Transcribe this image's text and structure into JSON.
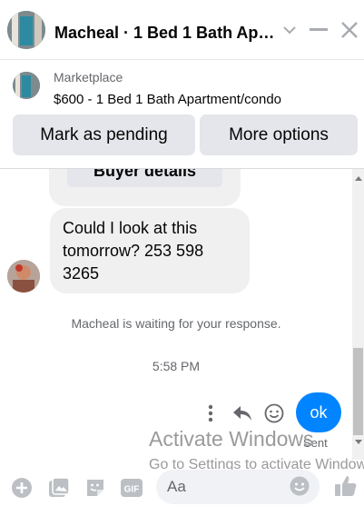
{
  "header": {
    "title": "Macheal · 1 Bed 1 Bath Apa...",
    "icons": [
      "chevron-down-icon",
      "minimize-icon",
      "close-icon"
    ]
  },
  "listing": {
    "label": "Marketplace",
    "title": "$600 - 1 Bed 1 Bath Apartment/condo",
    "buttons": {
      "pending": "Mark as pending",
      "more": "More options"
    }
  },
  "chat": {
    "buyer_details": "Buyer details",
    "message": "Could I look at this tomorrow? 253 598 3265",
    "status": "Macheal is waiting for your response.",
    "time": "5:58 PM",
    "outgoing": "ok",
    "sent_label": "Sent",
    "colors": {
      "outgoing_bubble": "#0084ff",
      "incoming_bubble": "#f0f0f0"
    }
  },
  "watermark": {
    "line1": "Activate Windows",
    "line2": "Go to Settings to activate Windows."
  },
  "composer": {
    "placeholder": "Aa",
    "icons": [
      "add-icon",
      "photo-icon",
      "sticker-icon",
      "gif-icon",
      "emoji-icon",
      "like-icon"
    ],
    "gif_label": "GIF"
  }
}
